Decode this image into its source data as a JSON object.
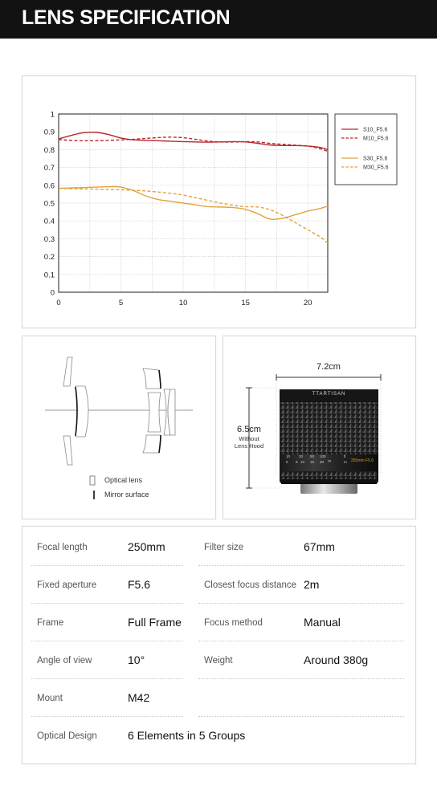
{
  "header": {
    "title": "LENS SPECIFICATION"
  },
  "colors": {
    "header_bg": "#121212",
    "s10": "#b8262b",
    "m10": "#b8262b",
    "s30": "#e3a23c",
    "m30": "#e3a23c"
  },
  "chart_data": {
    "type": "line",
    "title": "",
    "xlabel": "",
    "ylabel": "",
    "xlim": [
      0,
      21.6
    ],
    "ylim": [
      0,
      1
    ],
    "grid": true,
    "legend_position": "right",
    "x_ticks": [
      "0",
      "5",
      "10",
      "15",
      "20"
    ],
    "y_ticks": [
      "0",
      "0.1",
      "0.2",
      "0.3",
      "0.4",
      "0.5",
      "0.6",
      "0.7",
      "0.8",
      "0.9",
      "1"
    ],
    "x": [
      0,
      1,
      2,
      3,
      4,
      5,
      6,
      7,
      8,
      9,
      10,
      11,
      12,
      13,
      14,
      15,
      16,
      17,
      18,
      19,
      20,
      21,
      21.6
    ],
    "series": [
      {
        "name": "S10_F5.6",
        "style": "solid",
        "values": [
          0.86,
          0.88,
          0.895,
          0.897,
          0.885,
          0.865,
          0.855,
          0.852,
          0.85,
          0.847,
          0.845,
          0.843,
          0.842,
          0.843,
          0.845,
          0.843,
          0.835,
          0.826,
          0.823,
          0.823,
          0.82,
          0.812,
          0.8
        ]
      },
      {
        "name": "M10_F5.6",
        "style": "dashed",
        "values": [
          0.857,
          0.852,
          0.85,
          0.85,
          0.852,
          0.855,
          0.858,
          0.863,
          0.868,
          0.87,
          0.867,
          0.858,
          0.848,
          0.843,
          0.843,
          0.845,
          0.843,
          0.835,
          0.83,
          0.825,
          0.82,
          0.805,
          0.79
        ]
      },
      {
        "name": "S30_F5.6",
        "style": "solid",
        "values": [
          0.583,
          0.585,
          0.587,
          0.59,
          0.592,
          0.59,
          0.57,
          0.54,
          0.52,
          0.51,
          0.5,
          0.49,
          0.48,
          0.478,
          0.475,
          0.465,
          0.44,
          0.41,
          0.415,
          0.435,
          0.455,
          0.47,
          0.483
        ]
      },
      {
        "name": "M30_F5.6",
        "style": "dashed",
        "values": [
          0.582,
          0.581,
          0.58,
          0.578,
          0.577,
          0.575,
          0.572,
          0.568,
          0.562,
          0.555,
          0.545,
          0.53,
          0.515,
          0.5,
          0.488,
          0.48,
          0.478,
          0.462,
          0.43,
          0.39,
          0.35,
          0.31,
          0.275
        ]
      }
    ]
  },
  "diagram": {
    "legend": [
      {
        "symbol": "optical-lens",
        "label": "Optical lens"
      },
      {
        "symbol": "mirror-surface",
        "label": "Mirror surface"
      }
    ]
  },
  "product": {
    "width_label": "7.2cm",
    "height_label": "6.5cm",
    "height_note_1": "Without",
    "height_note_2": "Lens Hood",
    "brand": "TTARTISAN",
    "lens_marking": "250mm F5.6",
    "scale_top": [
      "10",
      "20",
      "50",
      "100"
    ],
    "scale_bottom": [
      "5",
      "8",
      "10",
      "15",
      "30",
      "∞"
    ],
    "unit_ft": "ft",
    "unit_m": "m"
  },
  "specs": [
    {
      "label": "Focal length",
      "value": "250mm"
    },
    {
      "label": "Filter size",
      "value": "67mm"
    },
    {
      "label": "Fixed aperture",
      "value": "F5.6"
    },
    {
      "label": "Closest focus distance",
      "value": "2m"
    },
    {
      "label": "Frame",
      "value": "Full Frame"
    },
    {
      "label": "Focus method",
      "value": "Manual"
    },
    {
      "label": "Angle of view",
      "value": "10°"
    },
    {
      "label": "Weight",
      "value": "Around 380g"
    },
    {
      "label": "Mount",
      "value": "M42"
    },
    {
      "label": "Optical Design",
      "value": "6 Elements in 5 Groups"
    }
  ]
}
